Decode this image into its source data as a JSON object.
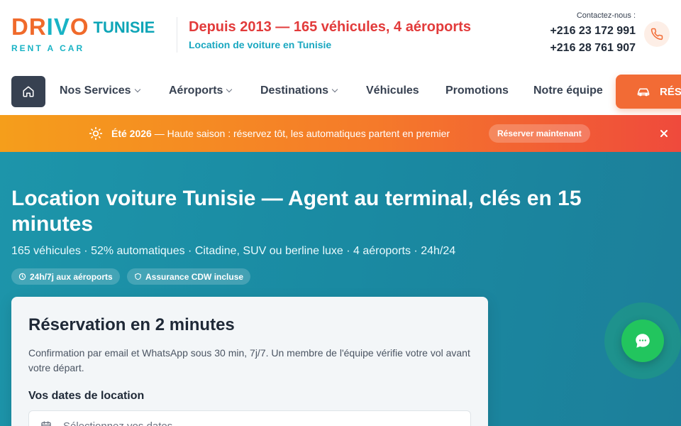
{
  "brand": {
    "part1": "DR",
    "part2": "IV",
    "part3": "O",
    "country": "TUNISIE",
    "sub": "RENT A CAR"
  },
  "tagline": {
    "main": "Depuis 2013 — 165 véhicules, 4 aéroports",
    "sub": "Location de voiture en Tunisie"
  },
  "contact": {
    "label": "Contactez-nous :",
    "phone1": "+216 23 172 991",
    "phone2": "+216 28 761 907"
  },
  "nav": {
    "services": "Nos Services",
    "airports": "Aéroports",
    "destinations": "Destinations",
    "vehicles": "Véhicules",
    "promotions": "Promotions",
    "team": "Notre équipe",
    "reserve": "RÉS"
  },
  "banner": {
    "season": "Été 2026",
    "message": " — Haute saison : réservez tôt, les automatiques partent en premier",
    "cta": "Réserver maintenant"
  },
  "hero": {
    "title": "Location voiture Tunisie — Agent au terminal, clés en 15 minutes",
    "subtitle": "165 véhicules · 52% automatiques · Citadine, SUV ou berline luxe · 4 aéroports · 24h/24",
    "badge1": "24h/7j aux aéroports",
    "badge2": "Assurance CDW incluse"
  },
  "booking": {
    "title": "Réservation en 2 minutes",
    "description": "Confirmation par email et WhatsApp sous 30 min, 7j/7. Un membre de l'équipe vérifie votre vol avant votre départ.",
    "dates_label": "Vos dates de location",
    "dates_placeholder": "Sélectionnez vos dates"
  },
  "colors": {
    "accent": "#f26b35",
    "brand_teal": "#19b3c5",
    "hero_bg": "#1a8aa2",
    "chat_green": "#22c55e"
  }
}
